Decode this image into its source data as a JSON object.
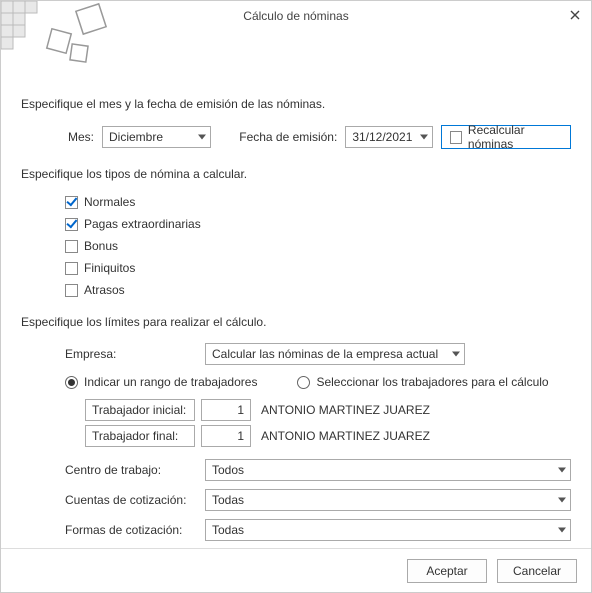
{
  "window": {
    "title": "Cálculo de nóminas"
  },
  "section1": {
    "label": "Especifique el mes y la fecha de emisión de las nóminas.",
    "mesLabel": "Mes:",
    "mesValue": "Diciembre",
    "fechaLabel": "Fecha de emisión:",
    "fechaValue": "31/12/2021",
    "recalcLabel": "Recalcular nóminas"
  },
  "section2": {
    "label": "Especifique los tipos de nómina a calcular.",
    "items": [
      {
        "label": "Normales",
        "checked": true
      },
      {
        "label": "Pagas extraordinarias",
        "checked": true
      },
      {
        "label": "Bonus",
        "checked": false
      },
      {
        "label": "Finiquitos",
        "checked": false
      },
      {
        "label": "Atrasos",
        "checked": false
      }
    ]
  },
  "section3": {
    "label": "Especifique los límites para realizar el cálculo.",
    "empresaLabel": "Empresa:",
    "empresaValue": "Calcular las nóminas de la empresa actual",
    "radio1": "Indicar un rango de trabajadores",
    "radio2": "Seleccionar los trabajadores para el cálculo",
    "trabInicialLabel": "Trabajador inicial:",
    "trabInicialNum": "1",
    "trabInicialName": "ANTONIO MARTINEZ JUAREZ",
    "trabFinalLabel": "Trabajador final:",
    "trabFinalNum": "1",
    "trabFinalName": "ANTONIO MARTINEZ JUAREZ",
    "centroLabel": "Centro de trabajo:",
    "centroValue": "Todos",
    "cuentasLabel": "Cuentas de cotización:",
    "cuentasValue": "Todas",
    "formasLabel": "Formas de cotización:",
    "formasValue": "Todas"
  },
  "footer": {
    "ok": "Aceptar",
    "cancel": "Cancelar"
  }
}
